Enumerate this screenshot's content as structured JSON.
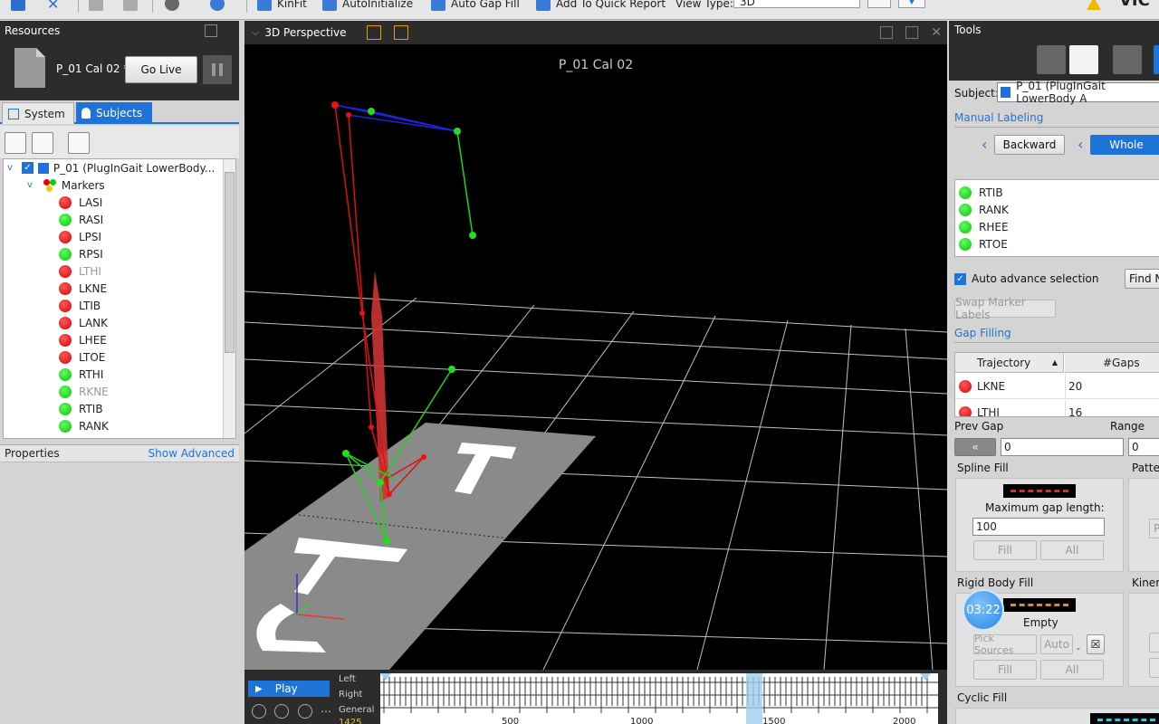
{
  "toolbar": {
    "kinfit": "KinFit",
    "autoinit": "AutoInitialize",
    "autogap": "Auto Gap Fill",
    "quickreport": "Add To Quick Report",
    "viewtype_label": "View Type:",
    "viewtype_value": "3D"
  },
  "resources": {
    "title": "Resources",
    "file_name": "P_01 Cal 02 *",
    "go_live": "Go Live"
  },
  "tabs": {
    "system": "System",
    "subjects": "Subjects"
  },
  "tree": {
    "subject": "P_01 (PlugInGait LowerBody...",
    "markers_label": "Markers",
    "markers": [
      {
        "name": "LASI",
        "color": "red",
        "dim": false
      },
      {
        "name": "RASI",
        "color": "green",
        "dim": false
      },
      {
        "name": "LPSI",
        "color": "red",
        "dim": false
      },
      {
        "name": "RPSI",
        "color": "green",
        "dim": false
      },
      {
        "name": "LTHI",
        "color": "red",
        "dim": true
      },
      {
        "name": "LKNE",
        "color": "red",
        "dim": false
      },
      {
        "name": "LTIB",
        "color": "red",
        "dim": false
      },
      {
        "name": "LANK",
        "color": "red",
        "dim": false
      },
      {
        "name": "LHEE",
        "color": "red",
        "dim": false
      },
      {
        "name": "LTOE",
        "color": "red",
        "dim": false
      },
      {
        "name": "RTHI",
        "color": "green",
        "dim": false
      },
      {
        "name": "RKNE",
        "color": "green",
        "dim": true
      },
      {
        "name": "RTIB",
        "color": "green",
        "dim": false
      },
      {
        "name": "RANK",
        "color": "green",
        "dim": false
      }
    ]
  },
  "properties": {
    "title": "Properties",
    "show_advanced": "Show Advanced"
  },
  "viewport": {
    "pane_title": "3D Perspective",
    "title": "P_01 Cal 02"
  },
  "timeline": {
    "play": "Play",
    "left": "Left",
    "right": "Right",
    "general": "General",
    "frame": "1425",
    "ticks": [
      "500",
      "1000",
      "1500",
      "2000"
    ]
  },
  "tools": {
    "title": "Tools",
    "subject_label": "Subject:",
    "subject_value": "P_01 (PlugInGait LowerBody A",
    "manual_labeling": "Manual Labeling",
    "backward": "Backward",
    "whole": "Whole",
    "label_markers": [
      "RTIB",
      "RANK",
      "RHEE",
      "RTOE"
    ],
    "auto_advance": "Auto advance selection",
    "find": "Find N",
    "swap": "Swap Marker Labels",
    "gap_filling": "Gap Filling",
    "col_trajectory": "Trajectory",
    "col_gaps": "#Gaps",
    "gap_rows": [
      {
        "name": "LKNE",
        "gaps": "20"
      },
      {
        "name": "LTHI",
        "gaps": "16"
      }
    ],
    "prev_gap": "Prev Gap",
    "range": "Range",
    "prev_gap_value": "0",
    "range_value": "0",
    "spline_fill": "Spline Fill",
    "pattern": "Patter",
    "max_gap": "Maximum gap length:",
    "max_gap_value": "100",
    "fill": "Fill",
    "all": "All",
    "rigid_fill": "Rigid Body Fill",
    "kinematic": "Kinem",
    "empty": "Empty",
    "pick_sources": "Pick Sources",
    "auto": "Auto",
    "timer": "03:22",
    "cyclic_fill": "Cyclic Fill"
  }
}
